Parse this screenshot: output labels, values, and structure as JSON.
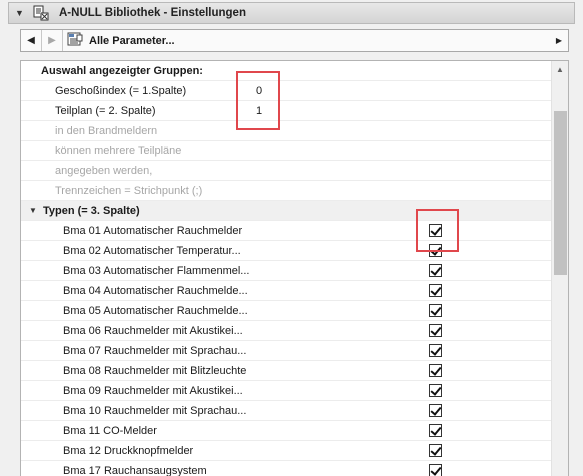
{
  "header": {
    "toggle_icon": "triangle-down-icon",
    "title": "A-NULL Bibliothek - Einstellungen"
  },
  "toolbar": {
    "back_icon": "◀",
    "forward_icon": "▶",
    "dropdown_label": "Alle Parameter...",
    "dropdown_arrow": "▶"
  },
  "list": {
    "group_label": "Auswahl angezeigter Gruppen:",
    "params": [
      {
        "label": "Geschoßindex (= 1.Spalte)",
        "value": "0"
      },
      {
        "label": "Teilplan (= 2. Spalte)",
        "value": "1"
      }
    ],
    "notes": [
      "in den Brandmeldern",
      "können mehrere Teilpläne",
      "angegeben werden,",
      "Trennzeichen = Strichpunkt (;)"
    ],
    "types_label": "Typen (= 3. Spalte)",
    "types": [
      {
        "label": "Bma 01 Automatischer Rauchmelder",
        "checked": true
      },
      {
        "label": "Bma 02 Automatischer Temperatur...",
        "checked": true
      },
      {
        "label": "Bma 03 Automatischer Flammenmel...",
        "checked": true
      },
      {
        "label": "Bma 04 Automatischer Rauchmelde...",
        "checked": true
      },
      {
        "label": "Bma 05 Automatischer Rauchmelde...",
        "checked": true
      },
      {
        "label": "Bma 06 Rauchmelder mit Akustikei...",
        "checked": true
      },
      {
        "label": "Bma 07 Rauchmelder mit Sprachau...",
        "checked": true
      },
      {
        "label": "Bma 08 Rauchmelder mit Blitzleuchte",
        "checked": true
      },
      {
        "label": "Bma 09 Rauchmelder mit Akustikei...",
        "checked": true
      },
      {
        "label": "Bma 10 Rauchmelder mit Sprachau...",
        "checked": true
      },
      {
        "label": "Bma 11 CO-Melder",
        "checked": true
      },
      {
        "label": "Bma 12 Druckknopfmelder",
        "checked": true
      },
      {
        "label": "Bma 17 Rauchansaugsystem",
        "checked": true
      }
    ]
  },
  "colors": {
    "highlight": "#e0474c"
  }
}
